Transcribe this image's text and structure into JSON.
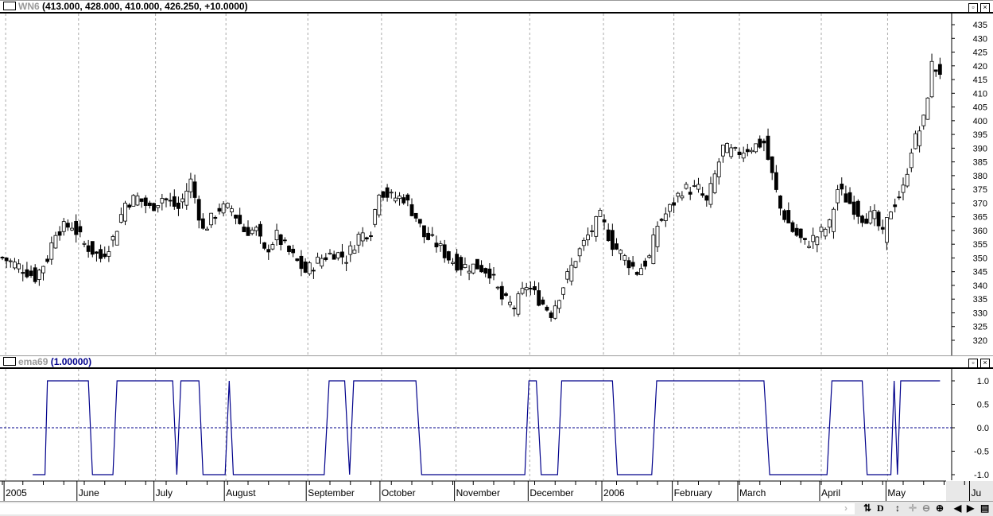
{
  "price_pane": {
    "symbol": "WN6",
    "values": "(413.000, 428.000, 410.000, 426.250, +10.0000)"
  },
  "indicator_pane": {
    "symbol": "ema69",
    "values": "(1.00000)"
  },
  "toolbar": {
    "d_label": "D",
    "icons": [
      "scroll-right-icon",
      "sync-icon",
      "d-button",
      "vertical-zoom-icon",
      "crosshair-icon",
      "zoom-out-icon",
      "zoom-in-icon",
      "prev-icon",
      "next-icon",
      "properties-icon"
    ]
  },
  "chart_data": [
    {
      "type": "candlestick",
      "title": "WN6",
      "y_ticks": [
        320,
        325,
        330,
        335,
        340,
        345,
        350,
        355,
        360,
        365,
        370,
        375,
        380,
        385,
        390,
        395,
        400,
        405,
        410,
        415,
        420,
        425,
        430,
        435
      ],
      "ylim": [
        318,
        437
      ],
      "close_keypoints": [
        [
          0,
          350
        ],
        [
          4,
          347
        ],
        [
          8,
          343
        ],
        [
          11,
          350
        ],
        [
          13,
          360
        ],
        [
          17,
          362
        ],
        [
          20,
          355
        ],
        [
          24,
          350
        ],
        [
          27,
          357
        ],
        [
          30,
          370
        ],
        [
          33,
          372
        ],
        [
          36,
          368
        ],
        [
          39,
          372
        ],
        [
          43,
          368
        ],
        [
          46,
          378
        ],
        [
          49,
          360
        ],
        [
          53,
          368
        ],
        [
          56,
          368
        ],
        [
          59,
          360
        ],
        [
          62,
          360
        ],
        [
          64,
          352
        ],
        [
          67,
          358
        ],
        [
          70,
          352
        ],
        [
          74,
          345
        ],
        [
          78,
          350
        ],
        [
          81,
          352
        ],
        [
          84,
          350
        ],
        [
          87,
          358
        ],
        [
          90,
          360
        ],
        [
          92,
          375
        ],
        [
          95,
          372
        ],
        [
          98,
          372
        ],
        [
          101,
          365
        ],
        [
          103,
          358
        ],
        [
          106,
          355
        ],
        [
          109,
          350
        ],
        [
          112,
          347
        ],
        [
          116,
          347
        ],
        [
          119,
          345
        ],
        [
          122,
          335
        ],
        [
          125,
          332
        ],
        [
          128,
          340
        ],
        [
          131,
          335
        ],
        [
          134,
          330
        ],
        [
          137,
          340
        ],
        [
          140,
          350
        ],
        [
          143,
          358
        ],
        [
          146,
          365
        ],
        [
          149,
          355
        ],
        [
          152,
          350
        ],
        [
          155,
          345
        ],
        [
          158,
          350
        ],
        [
          160,
          362
        ],
        [
          163,
          368
        ],
        [
          166,
          375
        ],
        [
          170,
          375
        ],
        [
          172,
          370
        ],
        [
          174,
          380
        ],
        [
          176,
          390
        ],
        [
          179,
          388
        ],
        [
          182,
          390
        ],
        [
          186,
          392
        ],
        [
          188,
          380
        ],
        [
          190,
          368
        ],
        [
          193,
          360
        ],
        [
          196,
          355
        ],
        [
          199,
          358
        ],
        [
          202,
          362
        ],
        [
          204,
          375
        ],
        [
          207,
          370
        ],
        [
          210,
          365
        ],
        [
          213,
          365
        ],
        [
          215,
          358
        ],
        [
          217,
          368
        ],
        [
          220,
          375
        ],
        [
          222,
          390
        ],
        [
          225,
          400
        ],
        [
          227,
          420
        ],
        [
          229,
          418
        ]
      ]
    },
    {
      "type": "line",
      "title": "ema69",
      "y_ticks": [
        "1.0",
        "0.5",
        "0.0",
        "-0.5",
        "-1.0"
      ],
      "ylim": [
        -1,
        1
      ],
      "color": "#00008b",
      "points": [
        [
          7.4,
          -1
        ],
        [
          10.4,
          -1
        ],
        [
          11,
          1
        ],
        [
          21,
          1
        ],
        [
          22,
          -1
        ],
        [
          27,
          -1
        ],
        [
          28,
          1
        ],
        [
          41.6,
          1
        ],
        [
          42.6,
          -1
        ],
        [
          43.6,
          1
        ],
        [
          48,
          1
        ],
        [
          49,
          -1
        ],
        [
          54.4,
          -1
        ],
        [
          55.4,
          1
        ],
        [
          56.4,
          -1
        ],
        [
          78.6,
          -1
        ],
        [
          79.8,
          1
        ],
        [
          83.6,
          1
        ],
        [
          84.8,
          -1
        ],
        [
          85.8,
          1
        ],
        [
          101,
          1
        ],
        [
          102.4,
          -1
        ],
        [
          127.6,
          -1
        ],
        [
          128.6,
          1
        ],
        [
          130.4,
          1
        ],
        [
          131.6,
          -1
        ],
        [
          135.6,
          -1
        ],
        [
          136.6,
          1
        ],
        [
          149,
          1
        ],
        [
          150.2,
          -1
        ],
        [
          158.6,
          -1
        ],
        [
          159.8,
          1
        ],
        [
          186,
          1
        ],
        [
          187.4,
          -1
        ],
        [
          201.4,
          -1
        ],
        [
          202.6,
          1
        ],
        [
          210,
          1
        ],
        [
          211.2,
          -1
        ],
        [
          217,
          -1
        ],
        [
          217.8,
          1
        ],
        [
          218.6,
          -1
        ],
        [
          219.4,
          1
        ],
        [
          220.4,
          1
        ],
        [
          229,
          1
        ]
      ]
    }
  ],
  "x_axis": {
    "labels": [
      [
        "2005",
        0.8
      ],
      [
        "June",
        18.6
      ],
      [
        "July",
        37.4
      ],
      [
        "August",
        54.6
      ],
      [
        "September",
        74.6
      ],
      [
        "October",
        92.6
      ],
      [
        "November",
        110.8
      ],
      [
        "December",
        128.8
      ],
      [
        "2006",
        146.8
      ],
      [
        "February",
        164
      ],
      [
        "March",
        180
      ],
      [
        "April",
        200
      ],
      [
        "May",
        216.2
      ],
      [
        "Ju",
        236.6
      ]
    ]
  }
}
